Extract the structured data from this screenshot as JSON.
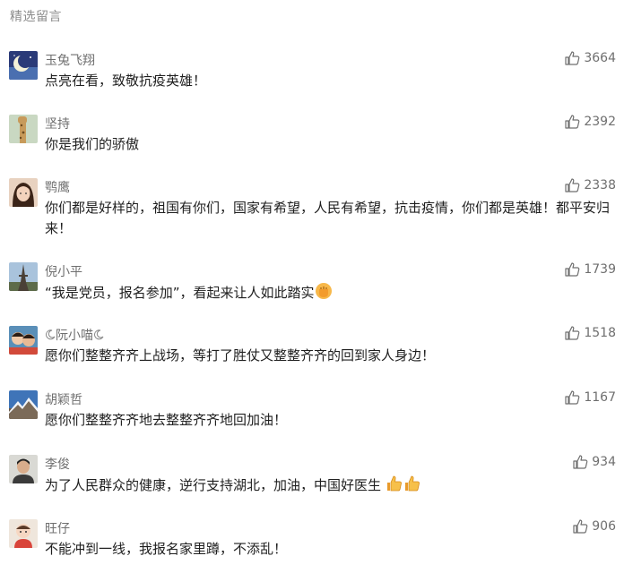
{
  "section_title": "精选留言",
  "comments": [
    {
      "nickname": "玉兔飞翔",
      "text": "点亮在看，致敬抗疫英雄！",
      "likes": "3664",
      "avatar": "moon-avatar"
    },
    {
      "nickname": "坚持",
      "text": "你是我们的骄傲",
      "likes": "2392",
      "avatar": "giraffe-avatar"
    },
    {
      "nickname": "鹗鹰",
      "text": "你们都是好样的，祖国有你们，国家有希望，人民有希望，抗击疫情，你们都是英雄！都平安归来！",
      "likes": "2338",
      "avatar": "girl-avatar"
    },
    {
      "nickname": "倪小平",
      "text": "“我是党员，报名参加”，看起来让人如此踏实",
      "likes": "1739",
      "avatar": "tower-avatar",
      "emoji": "fist-emoji"
    },
    {
      "nickname": "阮小喵",
      "text": "愿你们整整齐齐上战场，等打了胜仗又整整齐齐的回到家人身边！",
      "likes": "1518",
      "avatar": "kids-avatar",
      "nick_decor": "crescent-icon"
    },
    {
      "nickname": "胡颖哲",
      "text": "愿你们整整齐齐地去整整齐齐地回加油！",
      "likes": "1167",
      "avatar": "mountain-avatar"
    },
    {
      "nickname": "李俊",
      "text": "为了人民群众的健康，逆行支持湖北，加油，中国好医生",
      "likes": "934",
      "avatar": "man-avatar",
      "emoji": "thumbs-up-emoji"
    },
    {
      "nickname": "旺仔",
      "text": "不能冲到一线，我报名家里蹲，不添乱！",
      "likes": "906",
      "avatar": "doll-avatar"
    }
  ],
  "colors": {
    "title": "#8c8c8c",
    "nickname": "#6f6f6f",
    "text": "#1f1f1f",
    "like": "#6f6f6f"
  },
  "icons": {
    "like": "thumbs-up-outline-icon"
  }
}
